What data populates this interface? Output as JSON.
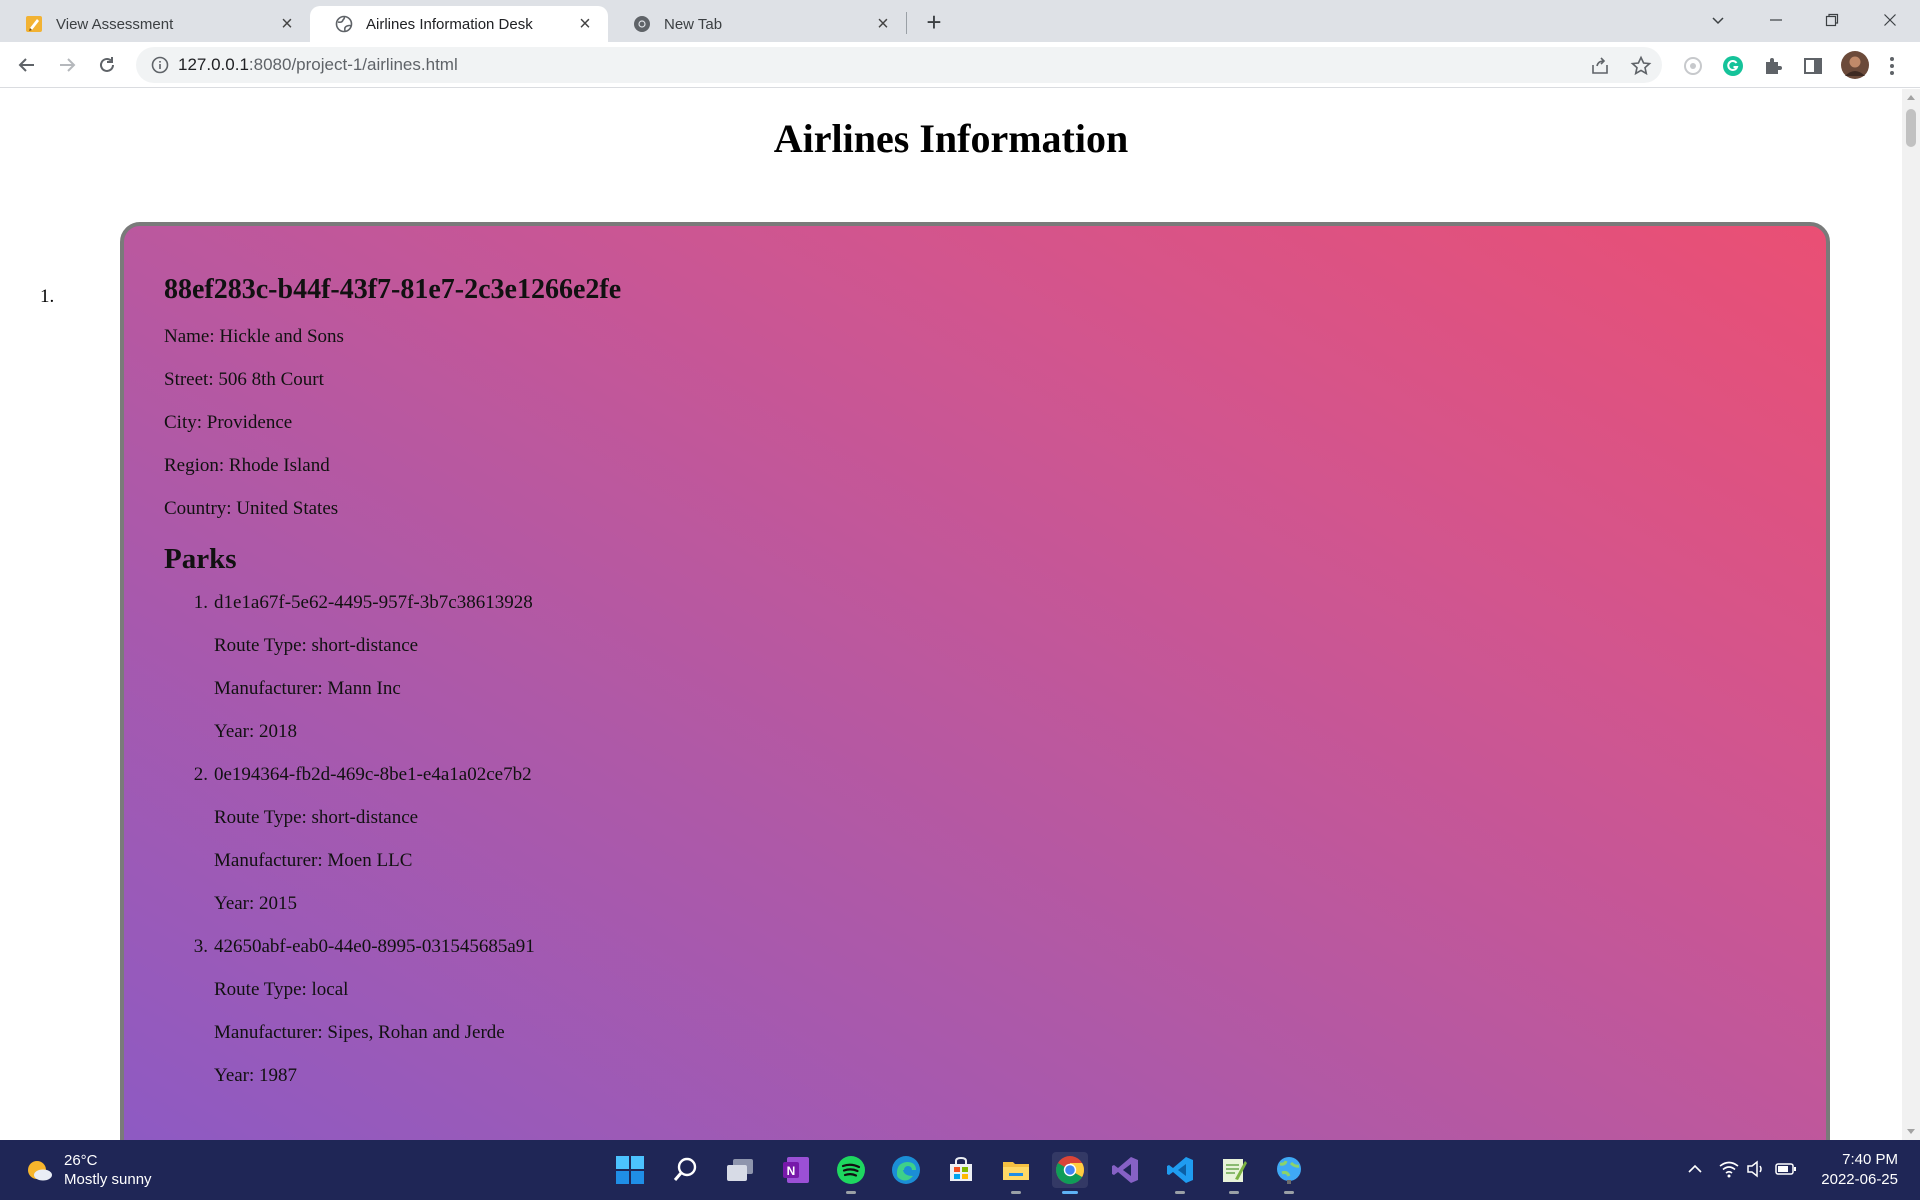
{
  "browser": {
    "tabs": [
      {
        "title": "View Assessment",
        "icon": "edit-doc-icon",
        "active": false
      },
      {
        "title": "Airlines Information Desk",
        "icon": "globe-icon",
        "active": true
      },
      {
        "title": "New Tab",
        "icon": "chrome-icon",
        "active": false
      }
    ],
    "address": {
      "host": "127.0.0.1",
      "rest": ":8080/project-1/airlines.html"
    }
  },
  "page": {
    "title": "Airlines Information",
    "airlines": [
      {
        "number": "1.",
        "id": "88ef283c-b44f-43f7-81e7-2c3e1266e2fe",
        "name": "Name: Hickle and Sons",
        "street": "Street: 506 8th Court",
        "city": "City: Providence",
        "region": "Region: Rhode Island",
        "country": "Country: United States",
        "parks_heading": "Parks",
        "parks": [
          {
            "number": "1.",
            "id": "d1e1a67f-5e62-4495-957f-3b7c38613928",
            "route": "Route Type: short-distance",
            "manufacturer": "Manufacturer: Mann Inc",
            "year": "Year: 2018"
          },
          {
            "number": "2.",
            "id": "0e194364-fb2d-469c-8be1-e4a1a02ce7b2",
            "route": "Route Type: short-distance",
            "manufacturer": "Manufacturer: Moen LLC",
            "year": "Year: 2015"
          },
          {
            "number": "3.",
            "id": "42650abf-eab0-44e0-8995-031545685a91",
            "route": "Route Type: local",
            "manufacturer": "Manufacturer: Sipes, Rohan and Jerde",
            "year": "Year: 1987"
          }
        ]
      }
    ]
  },
  "taskbar": {
    "weather": {
      "temp": "26°C",
      "desc": "Mostly sunny"
    },
    "clock": {
      "time": "7:40 PM",
      "date": "2022-06-25"
    }
  },
  "colors": {
    "card_gradient": [
      "#8a5ac6",
      "#ea4f74"
    ],
    "taskbar": "#1f2656",
    "tabstrip": "#dee1e6"
  }
}
